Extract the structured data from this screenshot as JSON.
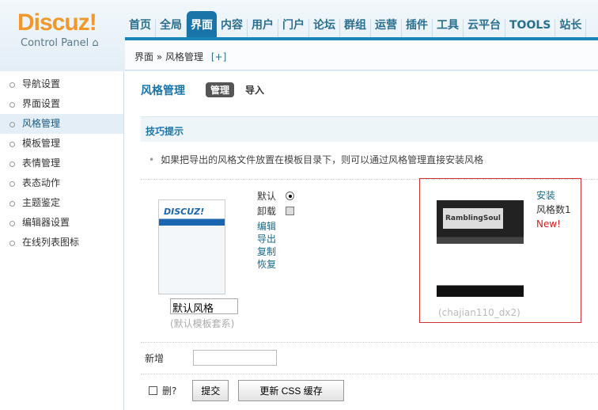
{
  "header": {
    "logo": "Discuz!",
    "subtitle": "Control Panel",
    "nav": [
      "首页",
      "全局",
      "界面",
      "内容",
      "用户",
      "门户",
      "论坛",
      "群组",
      "运营",
      "插件",
      "工具",
      "云平台",
      "TOOLS",
      "站长"
    ],
    "active_nav": 2
  },
  "breadcrumb": {
    "root": "界面",
    "sep": "»",
    "current": "风格管理",
    "add": "[+]"
  },
  "sidebar": {
    "items": [
      "导航设置",
      "界面设置",
      "风格管理",
      "模板管理",
      "表情管理",
      "表态动作",
      "主题鉴定",
      "编辑器设置",
      "在线列表图标"
    ],
    "active": 2
  },
  "main": {
    "title": "风格管理",
    "tabs": [
      "管理",
      "导入"
    ],
    "tips_title": "技巧提示",
    "tip": "如果把导出的风格文件放置在模板目录下，则可以通过风格管理直接安装风格",
    "style1": {
      "name": "默认风格",
      "subtitle": "(默认模板套系)",
      "default_label": "默认",
      "uninstall_label": "卸载",
      "actions": [
        "编辑",
        "导出",
        "复制",
        "恢复"
      ],
      "thumb_logo": "DISCUZ!"
    },
    "style2": {
      "subtitle": "(chajian110_dx2)",
      "install": "安装",
      "count": "风格数1",
      "new": "New!",
      "thumb_logo": "RamblingSoul"
    },
    "add_label": "新增",
    "delete_label": "删?",
    "submit": "提交",
    "refresh": "更新 CSS 缓存"
  }
}
